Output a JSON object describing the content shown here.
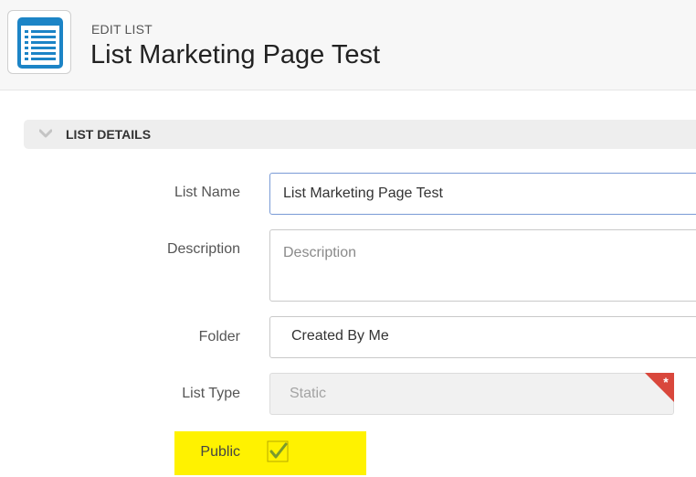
{
  "header": {
    "eyebrow": "EDIT LIST",
    "title": "List Marketing Page Test",
    "icon": "list-document-icon"
  },
  "section": {
    "title": "LIST DETAILS",
    "icon": "chevron-down-icon"
  },
  "form": {
    "list_name": {
      "label": "List Name",
      "value": "List Marketing Page Test"
    },
    "description": {
      "label": "Description",
      "placeholder": "Description",
      "value": ""
    },
    "folder": {
      "label": "Folder",
      "value": "Created By Me"
    },
    "list_type": {
      "label": "List Type",
      "value": "Static",
      "required_marker": "*"
    },
    "public": {
      "label": "Public",
      "checked": true
    }
  },
  "colors": {
    "highlight": "#fff200",
    "required_flag": "#d9473c",
    "checkmark": "#7a9a2e",
    "focus_border": "#7a9bd6"
  }
}
